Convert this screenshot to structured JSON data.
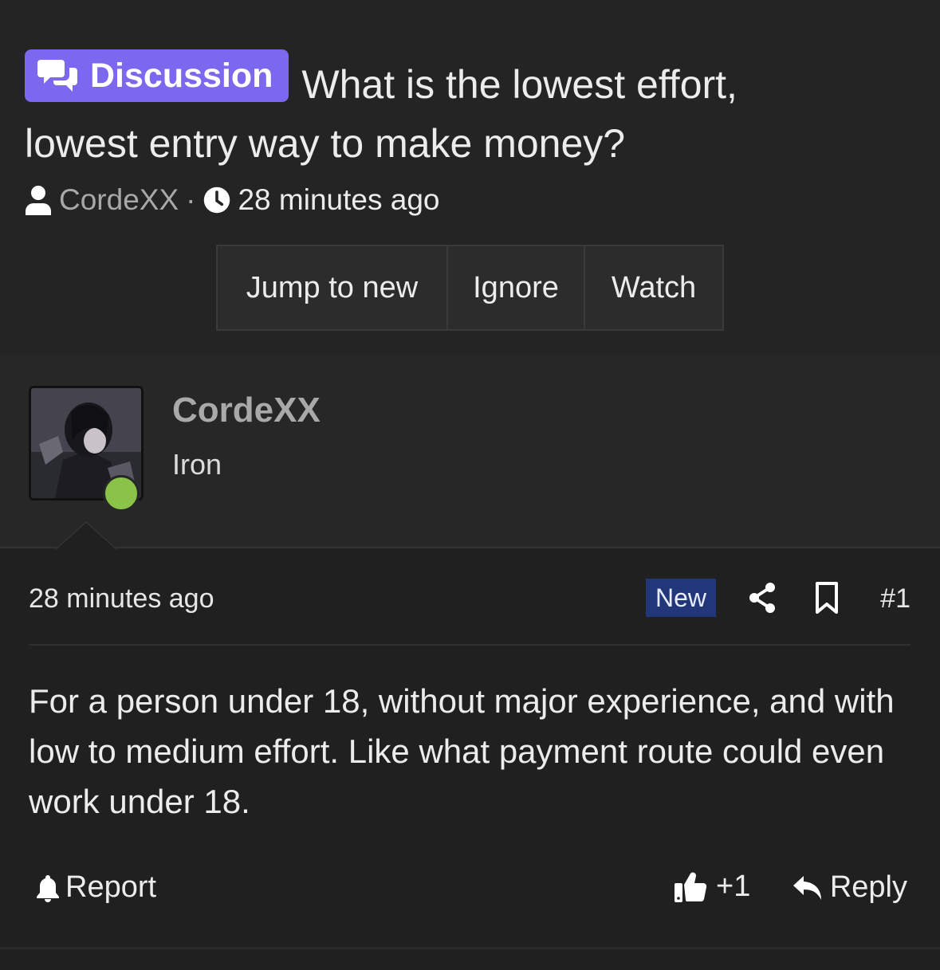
{
  "thread": {
    "prefix": "Discussion",
    "title": "What is the lowest effort, lowest entry way to make money?",
    "author": "CordeXX",
    "separator": "·",
    "time": "28 minutes ago"
  },
  "actions": {
    "jump_to_new": "Jump to new",
    "ignore": "Ignore",
    "watch": "Watch"
  },
  "post": {
    "username": "CordeXX",
    "user_title": "Iron",
    "date": "28 minutes ago",
    "new_label": "New",
    "number": "#1",
    "body": "For a person under 18, without major experience, and with low to medium effort. Like what payment route could even work under 18.",
    "report_label": "Report",
    "reaction_count": "+1",
    "reply_label": "Reply"
  },
  "colors": {
    "background": "#242424",
    "post_background": "#202020",
    "prefix_badge": "#7b68ee",
    "new_badge": "#22367a",
    "online_dot": "#8bc34a"
  },
  "icons": {
    "prefix": "chat-bubbles-icon",
    "author": "user-icon",
    "time": "clock-icon",
    "share": "share-icon",
    "bookmark": "bookmark-icon",
    "report": "bell-icon",
    "like": "thumbs-up-icon",
    "reply": "reply-arrow-icon"
  }
}
